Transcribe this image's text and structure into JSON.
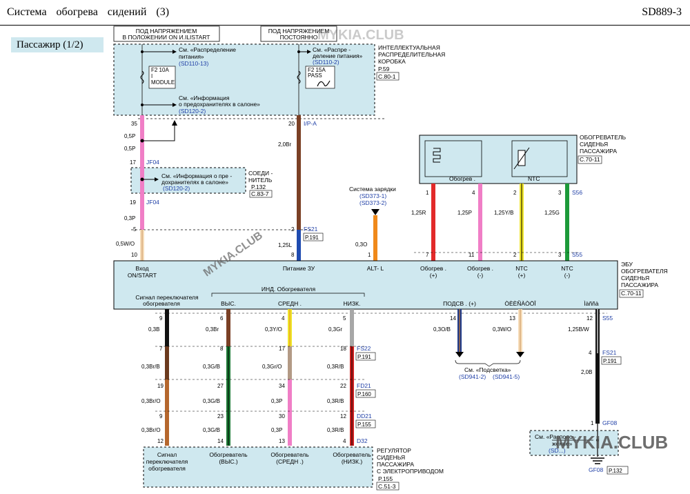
{
  "header": {
    "title": "Система обогрева сидений (3)",
    "code": "SD889-3"
  },
  "section_tag": "Пассажир (1/2)",
  "watermark": {
    "left": "MYKIA.CLUB",
    "right": "MYKIA.CLUB",
    "top": "MYKIA.CLUB"
  },
  "power_labels": {
    "ign_a": "ПОД НАПРЯЖЕНИЕМ",
    "ign_b": "В ПОЛОЖЕНИИ ON  И.ILISTART",
    "bat_a": "ПОД НАПРЯЖЕНИЕМ",
    "bat_b": "ПОСТОЯННО"
  },
  "junction_box": {
    "name": [
      "ИНТЕЛЛЕКТУАЛЬНАЯ",
      "РАСПРЕДЕЛИТЕЛЬНАЯ",
      "КОРОБКА"
    ],
    "page": "P.59",
    "conn": "С.80-1",
    "ref_power_1": [
      "См. «Распределение",
      "питания»"
    ],
    "ref_power_1_code": "(SD110-13)",
    "ref_power_2": [
      "См. «Распре -",
      "деление питания»"
    ],
    "ref_power_2_code": "(SD110-2)",
    "ref_info": [
      "См. «Информация",
      "о предохранителях    в салоне»"
    ],
    "ref_info_code": "(SD120-2)",
    "fuse1": [
      "F2 10A",
      "I",
      "MODULE"
    ],
    "fuse2": [
      "F2 15A",
      "PASS"
    ]
  },
  "connector": {
    "name": [
      "СОЕДИ -",
      "НИТЕЛЬ"
    ],
    "page": "P.132",
    "conn": "С.83-7",
    "ref": [
      "См. «Информация    о пре -",
      "дохранителях    в салоне»"
    ],
    "ref_code": "(SD120-2)"
  },
  "heater": {
    "name": [
      "ОБОГРЕВАТЕЛЬ",
      "СИДЕНЬЯ",
      "ПАССАЖИРА"
    ],
    "conn": "С.70-11",
    "heat_label": "Обогрев .",
    "ntc_label": "NTC",
    "code_top": "S56"
  },
  "charging": {
    "label": "Система зарядки",
    "ref1": "(SD373-1)",
    "ref2": "(SD373-2)"
  },
  "ecu": {
    "name": [
      "ЭБУ",
      "ОБОГРЕВАТЕЛЯ",
      "СИДЕНЬЯ",
      "ПАССАЖИРА"
    ],
    "conn": "С.70-11",
    "labels": {
      "input": [
        "Вход",
        "ON/START"
      ],
      "power": "Питание  ЗУ",
      "alt": "ALT- L",
      "heat_p": [
        "Обогрев .",
        "(+)"
      ],
      "heat_n": [
        "Обогрев .",
        "(-)"
      ],
      "ntc_p": [
        "NTC",
        "(+)"
      ],
      "ntc_n": [
        "NTC",
        "(-)"
      ],
      "switch": [
        "Сигнал  переключателя",
        "обогревателя"
      ],
      "ind": "ИНД. Обогревателя",
      "high": "ВЫС.",
      "mid": "СРЕДН .",
      "low": "НИЗК.",
      "illum": "ПОДСВ . (+)",
      "dim": "ÒÈÈÑÀÒÖÎ",
      "ground": "Ìàññà"
    }
  },
  "illumination_ref": {
    "label": "См. «Подсветка»",
    "ref1": "(SD941-2)",
    "ref2": "(SD941-5)"
  },
  "ground_ref": {
    "lines": [
      "См. «Располо -",
      "жение»"
    ],
    "code": "(SD...)",
    "gf": "GF08",
    "page": "P.132"
  },
  "switch_module": {
    "name": [
      "РЕГУЛЯТОР",
      "СИДЕНЬЯ",
      "ПАССАЖИРА",
      "С ЭЛЕКТРОПРИВОДОМ"
    ],
    "page": "P.155",
    "conn": "С.51-3",
    "labels": [
      [
        "Сигнал",
        "переключателя",
        "обогревателя"
      ],
      [
        "Обогреватель",
        "(ВЫС.)"
      ],
      [
        "Обогреватель",
        "(СРЕДН .)"
      ],
      [
        "Обогреватель",
        "(НИЗК.)"
      ]
    ]
  },
  "wires": {
    "ign_top": {
      "pins": [
        "35"
      ],
      "sizes": [
        "0,5P",
        "0,5P"
      ],
      "pin17": "17",
      "code17": "JF04",
      "pin19": "19",
      "code19": "JF04",
      "size_after": "0,3P",
      "pin5": "5",
      "size_bottom": "0,5W/O",
      "pin10": "10"
    },
    "bat": {
      "pin20": "20",
      "code20": "I/P-A",
      "size": "2,0Br",
      "pin2": "2",
      "code2": "FS21",
      "page2": "P.191",
      "size2": "1,25L",
      "pin8": "8"
    },
    "alt": {
      "size": "0,3O",
      "pin": "1"
    },
    "heat_p": {
      "top": "1",
      "size": "1,25R",
      "bot": "7"
    },
    "heat_n": {
      "top": "4",
      "size": "1,25P",
      "bot": "11"
    },
    "ntc_p": {
      "top": "2",
      "size": "1,25Y/B",
      "bot": "2"
    },
    "ntc_n": {
      "top": "3",
      "size": "1,25G",
      "bot": "3",
      "code": "S55"
    },
    "c1": {
      "pins": [
        "9",
        "7",
        "19",
        "9",
        "12"
      ],
      "sizes": [
        "0,3B",
        "0,3Br/B",
        "0,3Br/O",
        "0,3Br/O"
      ]
    },
    "c2": {
      "pins": [
        "6",
        "8",
        "27",
        "23",
        "14"
      ],
      "sizes": [
        "0,3Br",
        "0,3G/B",
        "0,3G/B",
        "0,3G/B"
      ]
    },
    "c3": {
      "pins": [
        "4",
        "17",
        "34",
        "30",
        "13"
      ],
      "sizes": [
        "0,3Y/O",
        "0,3Gr/O",
        "0,3P",
        "0,3P"
      ]
    },
    "c4": {
      "pins": [
        "5",
        "18",
        "22",
        "12",
        "4"
      ],
      "sizes": [
        "0,3Gr",
        "0,3R/B",
        "0,3R/B",
        "0,3R/B"
      ],
      "codes": [
        "FS22",
        "FD21",
        "DD21",
        "D32"
      ],
      "pages": [
        "P.191",
        "P.160",
        "P.155"
      ]
    },
    "illum": {
      "pin": "14",
      "size": "0,3O/B"
    },
    "dim": {
      "pin": "13",
      "size": "0,3W/O"
    },
    "gnd": {
      "pin12": "12",
      "code12": "S55",
      "size": "1,25B/W",
      "pin4": "4",
      "code4": "FS21",
      "page4": "P.191",
      "size2": "2,0B",
      "pin1": "1",
      "code1": "GF08"
    }
  }
}
